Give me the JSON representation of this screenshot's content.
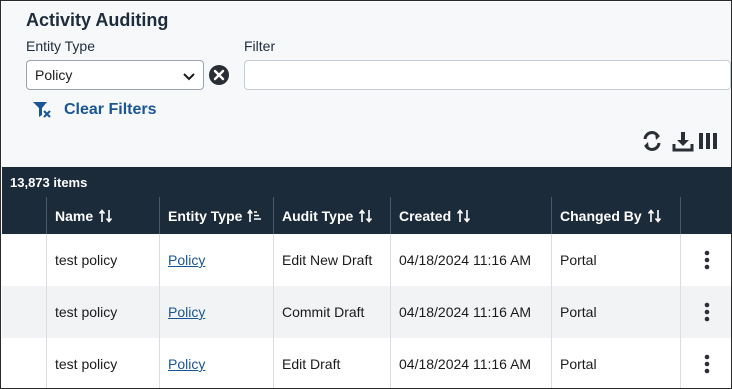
{
  "page": {
    "title": "Activity Auditing"
  },
  "filters": {
    "entity_type_label": "Entity Type",
    "entity_type_value": "Policy",
    "filter_label": "Filter",
    "filter_value": "",
    "filter_placeholder": "",
    "clear_filters_label": "Clear Filters"
  },
  "toolbar": {
    "icons": [
      "refresh-icon",
      "download-icon",
      "columns-icon"
    ]
  },
  "table": {
    "item_count": "13,873 items",
    "columns": [
      {
        "label": "Name",
        "sort": "unsorted"
      },
      {
        "label": "Entity Type",
        "sort": "ascending"
      },
      {
        "label": "Audit Type",
        "sort": "unsorted"
      },
      {
        "label": "Created",
        "sort": "unsorted"
      },
      {
        "label": "Changed By",
        "sort": "unsorted"
      }
    ],
    "rows": [
      {
        "name": "test policy",
        "entity_type": "Policy",
        "audit_type": "Edit New Draft",
        "created": "04/18/2024 11:16 AM",
        "changed_by": "Portal"
      },
      {
        "name": "test policy",
        "entity_type": "Policy",
        "audit_type": "Commit Draft",
        "created": "04/18/2024 11:16 AM",
        "changed_by": "Portal"
      },
      {
        "name": "test policy",
        "entity_type": "Policy",
        "audit_type": "Edit Draft",
        "created": "04/18/2024 11:16 AM",
        "changed_by": "Portal"
      }
    ]
  },
  "colors": {
    "header_bg": "#1c2b3a",
    "link": "#1a5596",
    "panel_bg": "#f7f8fa"
  }
}
